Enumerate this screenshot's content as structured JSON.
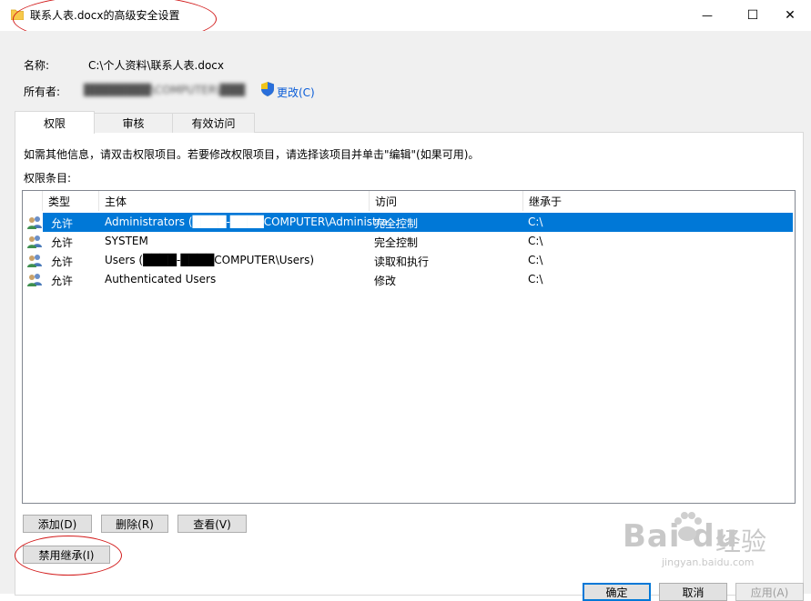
{
  "window": {
    "title": "联系人表.docx的高级安全设置",
    "minimize_glyph": "—",
    "maximize_glyph": "☐",
    "close_glyph": "✕"
  },
  "info": {
    "name_label": "名称:",
    "name_value": "C:\\个人资料\\联系人表.docx",
    "owner_label": "所有者:",
    "owner_value": "████████\\COMPUTER\\███",
    "change_link": "更改(C)"
  },
  "tabs": [
    {
      "label": "权限",
      "active": true
    },
    {
      "label": "审核",
      "active": false
    },
    {
      "label": "有效访问",
      "active": false
    }
  ],
  "instructions": "如需其他信息，请双击权限项目。若要修改权限项目，请选择该项目并单击\"编辑\"(如果可用)。",
  "entries_label": "权限条目:",
  "table": {
    "headers": [
      "类型",
      "主体",
      "访问",
      "继承于"
    ],
    "rows": [
      {
        "type": "允许",
        "principal": "Administrators (████-████COMPUTER\\Administra...",
        "access": "完全控制",
        "inherited": "C:\\",
        "selected": true
      },
      {
        "type": "允许",
        "principal": "SYSTEM",
        "access": "完全控制",
        "inherited": "C:\\",
        "selected": false
      },
      {
        "type": "允许",
        "principal": "Users (████-████COMPUTER\\Users)",
        "access": "读取和执行",
        "inherited": "C:\\",
        "selected": false
      },
      {
        "type": "允许",
        "principal": "Authenticated Users",
        "access": "修改",
        "inherited": "C:\\",
        "selected": false
      }
    ]
  },
  "buttons": {
    "add": "添加(D)",
    "remove": "删除(R)",
    "view": "查看(V)",
    "disable_inheritance": "禁用继承(I)",
    "ok": "确定",
    "cancel": "取消",
    "apply": "应用(A)"
  },
  "watermark": {
    "brand": "Bai  du",
    "brand_cn": "经验",
    "url": "jingyan.baidu.com"
  },
  "colors": {
    "selection": "#0078d7",
    "link": "#0a5dd8",
    "annotation": "#d21a1a"
  }
}
